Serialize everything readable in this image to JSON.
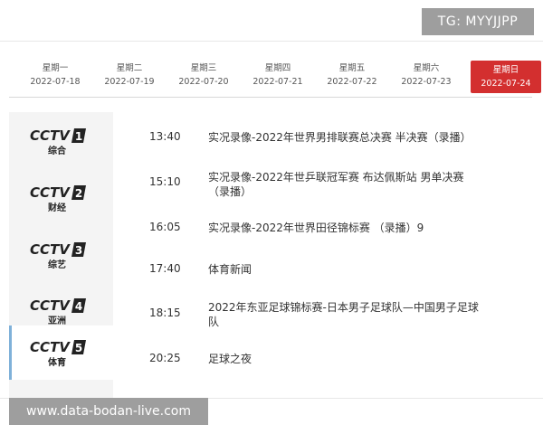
{
  "badge": "TG: MYYJJPP",
  "watermark": "www.data-bodan-live.com",
  "days": [
    {
      "weekday": "星期一",
      "date": "2022-07-18",
      "active": false
    },
    {
      "weekday": "星期二",
      "date": "2022-07-19",
      "active": false
    },
    {
      "weekday": "星期三",
      "date": "2022-07-20",
      "active": false
    },
    {
      "weekday": "星期四",
      "date": "2022-07-21",
      "active": false
    },
    {
      "weekday": "星期五",
      "date": "2022-07-22",
      "active": false
    },
    {
      "weekday": "星期六",
      "date": "2022-07-23",
      "active": false
    },
    {
      "weekday": "星期日",
      "date": "2022-07-24",
      "active": true
    }
  ],
  "channels": [
    {
      "brand": "CCTV",
      "number": "1",
      "name": "综合",
      "active": false
    },
    {
      "brand": "CCTV",
      "number": "2",
      "name": "财经",
      "active": false
    },
    {
      "brand": "CCTV",
      "number": "3",
      "name": "综艺",
      "active": false
    },
    {
      "brand": "CCTV",
      "number": "4",
      "name": "亚洲",
      "active": false
    },
    {
      "brand": "CCTV",
      "number": "5",
      "name": "体育",
      "active": true
    }
  ],
  "programs": [
    {
      "time": "13:40",
      "title": "实况录像-2022年世界男排联赛总决赛 半决赛（录播）"
    },
    {
      "time": "15:10",
      "title": "实况录像-2022年世乒联冠军赛 布达佩斯站 男单决赛（录播）"
    },
    {
      "time": "16:05",
      "title": "实况录像-2022年世界田径锦标赛 （录播）9"
    },
    {
      "time": "17:40",
      "title": "体育新闻"
    },
    {
      "time": "18:15",
      "title": "2022年东亚足球锦标赛-日本男子足球队—中国男子足球队"
    },
    {
      "time": "20:25",
      "title": "足球之夜"
    }
  ],
  "colors": {
    "accent": "#d32f2f",
    "active_border": "#7fb1d9"
  }
}
